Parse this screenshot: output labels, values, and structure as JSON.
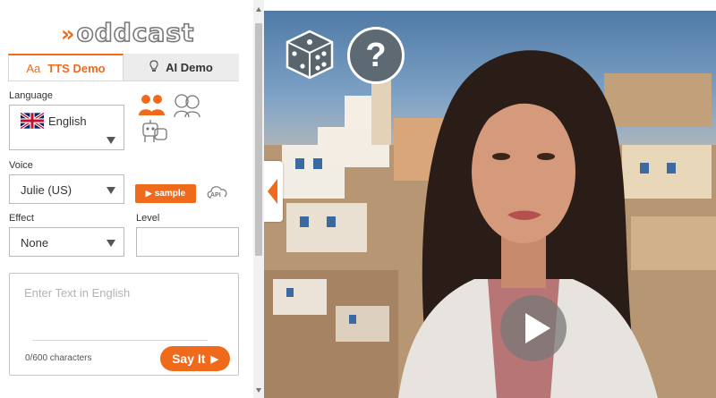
{
  "brand": {
    "logo_text": "oddcast",
    "logo_chevrons": "»",
    "accent": "#f06a1c"
  },
  "tabs": [
    {
      "label": "TTS Demo",
      "icon": "text-size-icon",
      "active": true
    },
    {
      "label": "AI Demo",
      "icon": "lightbulb-icon",
      "active": false
    }
  ],
  "language": {
    "label": "Language",
    "value": "English",
    "flag": "uk-flag-icon"
  },
  "voice": {
    "label": "Voice",
    "value": "Julie (US)"
  },
  "sample_button": {
    "label": "sample"
  },
  "api_icon": {
    "label": "API"
  },
  "effect": {
    "label": "Effect",
    "value": "None"
  },
  "level": {
    "label": "Level",
    "value": ""
  },
  "text_input": {
    "placeholder": "Enter Text in English",
    "value": ""
  },
  "char_counter": "0/600 characters",
  "say_it_button": {
    "label": "Say It"
  },
  "scene": {
    "help_label": "?"
  },
  "colors": {
    "tab_inactive_bg": "#ececec",
    "border": "#b9b9b9",
    "help_button": "#5d6a74"
  }
}
